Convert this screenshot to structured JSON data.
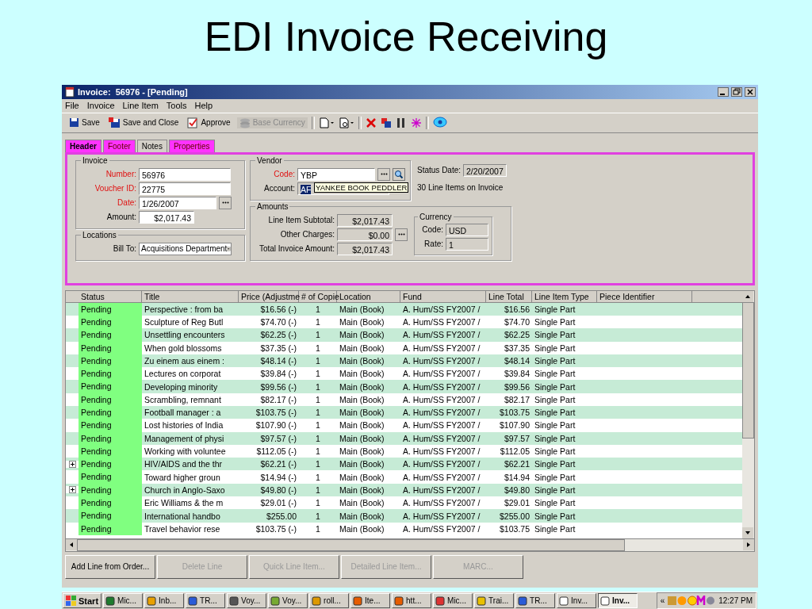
{
  "slide_title": "EDI Invoice Receiving",
  "window": {
    "title": "Invoice:  56976 - [Pending]"
  },
  "menu": [
    "File",
    "Invoice",
    "Line Item",
    "Tools",
    "Help"
  ],
  "toolbar": [
    {
      "label": "Save",
      "kind": "save",
      "disabled": false
    },
    {
      "label": "Save and Close",
      "kind": "saveclose",
      "disabled": false
    },
    {
      "label": "Approve",
      "kind": "approve",
      "disabled": false
    },
    {
      "label": "Base Currency",
      "kind": "currency",
      "disabled": true
    }
  ],
  "tabs": [
    {
      "label": "Header",
      "selected": true,
      "highlighted": true
    },
    {
      "label": "Footer",
      "selected": false,
      "highlighted": true
    },
    {
      "label": "Notes",
      "selected": false,
      "highlighted": false
    },
    {
      "label": "Properties",
      "selected": false,
      "highlighted": true
    }
  ],
  "invoice": {
    "legend": "Invoice",
    "fields": [
      {
        "label": "Number:",
        "value": "56976",
        "required": true,
        "picker": false,
        "kind": "text"
      },
      {
        "label": "Voucher ID:",
        "value": "22775",
        "required": true,
        "picker": false,
        "kind": "text"
      },
      {
        "label": "Date:",
        "value": "1/26/2007",
        "required": true,
        "picker": true,
        "kind": "text"
      },
      {
        "label": "Amount:",
        "value": "$2,017.43",
        "required": false,
        "picker": false,
        "kind": "money"
      }
    ]
  },
  "locations": {
    "legend": "Locations",
    "label": "Bill To:",
    "value": "Acquisitions Department"
  },
  "vendor": {
    "legend": "Vendor",
    "code_label": "Code:",
    "code": "YBP",
    "account_label": "Account:",
    "account": "AF",
    "tooltip": "YANKEE BOOK PEDDLER"
  },
  "status": {
    "label": "Status Date:",
    "value": "2/20/2007",
    "summary": "30 Line Items on Invoice"
  },
  "amounts": {
    "legend": "Amounts",
    "fields": [
      {
        "label": "Line Item Subtotal:",
        "value": "$2,017.43",
        "picker": false
      },
      {
        "label": "Other Charges:",
        "value": "$0.00",
        "picker": true
      },
      {
        "label": "Total Invoice Amount:",
        "value": "$2,017.43",
        "picker": false
      }
    ]
  },
  "currency": {
    "legend": "Currency",
    "fields": [
      {
        "label": "Code:",
        "value": "USD"
      },
      {
        "label": "Rate:",
        "value": "1"
      }
    ]
  },
  "table": {
    "columns": [
      "Status",
      "Title",
      "Price (Adjustme",
      "# of Copie",
      "Location",
      "Fund",
      "Line Total",
      "Line Item Type",
      "Piece Identifier"
    ],
    "rows": [
      {
        "expandable": false,
        "cells": [
          "Pending",
          "Perspective : from ba",
          "$16.56 (-)",
          "1",
          "Main (Book)",
          "A. Hum/SS FY2007 /",
          "$16.56",
          "Single Part"
        ]
      },
      {
        "expandable": false,
        "cells": [
          "Pending",
          "Sculpture of Reg Butl",
          "$74.70 (-)",
          "1",
          "Main (Book)",
          "A. Hum/SS FY2007 /",
          "$74.70",
          "Single Part"
        ]
      },
      {
        "expandable": false,
        "cells": [
          "Pending",
          "Unsettling encounters",
          "$62.25 (-)",
          "1",
          "Main (Book)",
          "A. Hum/SS FY2007 /",
          "$62.25",
          "Single Part"
        ]
      },
      {
        "expandable": false,
        "cells": [
          "Pending",
          "When gold blossoms",
          "$37.35 (-)",
          "1",
          "Main (Book)",
          "A. Hum/SS FY2007 /",
          "$37.35",
          "Single Part"
        ]
      },
      {
        "expandable": false,
        "cells": [
          "Pending",
          "Zu einem aus einem :",
          "$48.14 (-)",
          "1",
          "Main (Book)",
          "A. Hum/SS FY2007 /",
          "$48.14",
          "Single Part"
        ]
      },
      {
        "expandable": false,
        "cells": [
          "Pending",
          "Lectures on corporat",
          "$39.84 (-)",
          "1",
          "Main (Book)",
          "A. Hum/SS FY2007 /",
          "$39.84",
          "Single Part"
        ]
      },
      {
        "expandable": false,
        "cells": [
          "Pending",
          "Developing minority",
          "$99.56 (-)",
          "1",
          "Main (Book)",
          "A. Hum/SS FY2007 /",
          "$99.56",
          "Single Part"
        ]
      },
      {
        "expandable": false,
        "cells": [
          "Pending",
          "Scrambling, remnant",
          "$82.17 (-)",
          "1",
          "Main (Book)",
          "A. Hum/SS FY2007 /",
          "$82.17",
          "Single Part"
        ]
      },
      {
        "expandable": false,
        "cells": [
          "Pending",
          "Football manager : a",
          "$103.75 (-)",
          "1",
          "Main (Book)",
          "A. Hum/SS FY2007 /",
          "$103.75",
          "Single Part"
        ]
      },
      {
        "expandable": false,
        "cells": [
          "Pending",
          "Lost histories of India",
          "$107.90 (-)",
          "1",
          "Main (Book)",
          "A. Hum/SS FY2007 /",
          "$107.90",
          "Single Part"
        ]
      },
      {
        "expandable": false,
        "cells": [
          "Pending",
          "Management of physi",
          "$97.57 (-)",
          "1",
          "Main (Book)",
          "A. Hum/SS FY2007 /",
          "$97.57",
          "Single Part"
        ]
      },
      {
        "expandable": false,
        "cells": [
          "Pending",
          "Working with voluntee",
          "$112.05 (-)",
          "1",
          "Main (Book)",
          "A. Hum/SS FY2007 /",
          "$112.05",
          "Single Part"
        ]
      },
      {
        "expandable": true,
        "cells": [
          "Pending",
          "HIV/AIDS and the thr",
          "$62.21 (-)",
          "1",
          "Main (Book)",
          "A. Hum/SS FY2007 /",
          "$62.21",
          "Single Part"
        ]
      },
      {
        "expandable": false,
        "cells": [
          "Pending",
          "Toward higher groun",
          "$14.94 (-)",
          "1",
          "Main (Book)",
          "A. Hum/SS FY2007 /",
          "$14.94",
          "Single Part"
        ]
      },
      {
        "expandable": true,
        "cells": [
          "Pending",
          "Church in Anglo-Saxo",
          "$49.80 (-)",
          "1",
          "Main (Book)",
          "A. Hum/SS FY2007 /",
          "$49.80",
          "Single Part"
        ]
      },
      {
        "expandable": false,
        "cells": [
          "Pending",
          "Eric Williams & the m",
          "$29.01 (-)",
          "1",
          "Main (Book)",
          "A. Hum/SS FY2007 /",
          "$29.01",
          "Single Part"
        ]
      },
      {
        "expandable": false,
        "cells": [
          "Pending",
          "International handbo",
          "$255.00",
          "1",
          "Main (Book)",
          "A. Hum/SS FY2007 /",
          "$255.00",
          "Single Part"
        ]
      },
      {
        "expandable": false,
        "cells": [
          "Pending",
          "Travel behavior rese",
          "$103.75 (-)",
          "1",
          "Main (Book)",
          "A. Hum/SS FY2007 /",
          "$103.75",
          "Single Part"
        ]
      }
    ]
  },
  "actions": [
    {
      "label": "Add Line from Order...",
      "disabled": false
    },
    {
      "label": "Delete Line",
      "disabled": true
    },
    {
      "label": "Quick Line Item...",
      "disabled": true
    },
    {
      "label": "Detailed Line Item...",
      "disabled": true
    },
    {
      "label": "MARC...",
      "disabled": true
    }
  ],
  "taskbar": {
    "start": "Start",
    "items": [
      {
        "label": "Mic...",
        "selected": false
      },
      {
        "label": "Inb...",
        "selected": false
      },
      {
        "label": "TR...",
        "selected": false
      },
      {
        "label": "Voy...",
        "selected": false
      },
      {
        "label": "Voy...",
        "selected": false
      },
      {
        "label": "roll...",
        "selected": false
      },
      {
        "label": "Ite...",
        "selected": false
      },
      {
        "label": "htt...",
        "selected": false
      },
      {
        "label": "Mic...",
        "selected": false
      },
      {
        "label": "Trai...",
        "selected": false
      },
      {
        "label": "TR...",
        "selected": false
      },
      {
        "label": "Inv...",
        "selected": false
      },
      {
        "label": "Inv...",
        "selected": true
      }
    ],
    "tray_toggle": "«",
    "clock": "12:27 PM"
  }
}
